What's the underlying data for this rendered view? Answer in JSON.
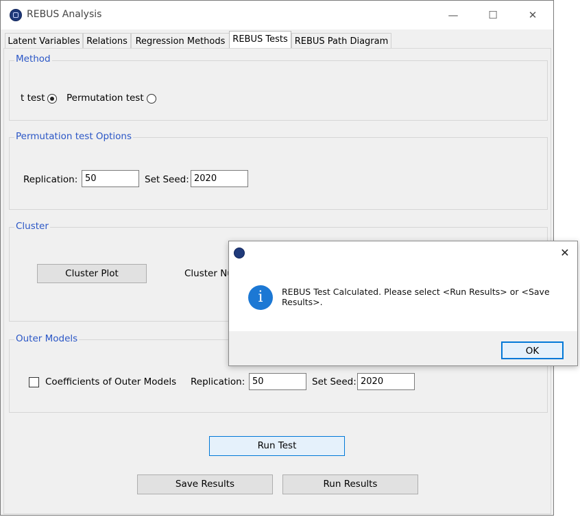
{
  "window": {
    "title": "REBUS Analysis",
    "controls": {
      "minimize": "—",
      "maximize": "☐",
      "close": "✕"
    }
  },
  "tabs": [
    {
      "label": "Latent Variables",
      "active": false
    },
    {
      "label": "Relations",
      "active": false
    },
    {
      "label": "Regression Methods",
      "active": false
    },
    {
      "label": "REBUS Tests",
      "active": true
    },
    {
      "label": "REBUS Path Diagram",
      "active": false
    }
  ],
  "method": {
    "title": "Method",
    "t_test_label": "t test",
    "t_test_selected": true,
    "permutation_label": "Permutation test",
    "permutation_selected": false
  },
  "permutation_options": {
    "title": "Permutation test Options",
    "replication_label": "Replication:",
    "replication_value": "50",
    "seed_label": "Set Seed:",
    "seed_value": "2020"
  },
  "cluster": {
    "title": "Cluster",
    "plot_button": "Cluster Plot",
    "number_label": "Cluster Nu"
  },
  "outer_models": {
    "title": "Outer Models",
    "coefficients_label": "Coefficients of Outer Models",
    "coefficients_checked": false,
    "replication_label": "Replication:",
    "replication_value": "50",
    "seed_label": "Set Seed:",
    "seed_value": "2020"
  },
  "actions": {
    "run_test": "Run Test",
    "save_results": "Save Results",
    "run_results": "Run Results"
  },
  "dialog": {
    "message": "REBUS Test Calculated. Please select <Run Results> or <Save Results>.",
    "info_glyph": "i",
    "ok": "OK",
    "close": "✕"
  },
  "colors": {
    "group_title": "#2a56c6",
    "info_icon": "#1c78d4",
    "focus_border": "#0078d7"
  }
}
